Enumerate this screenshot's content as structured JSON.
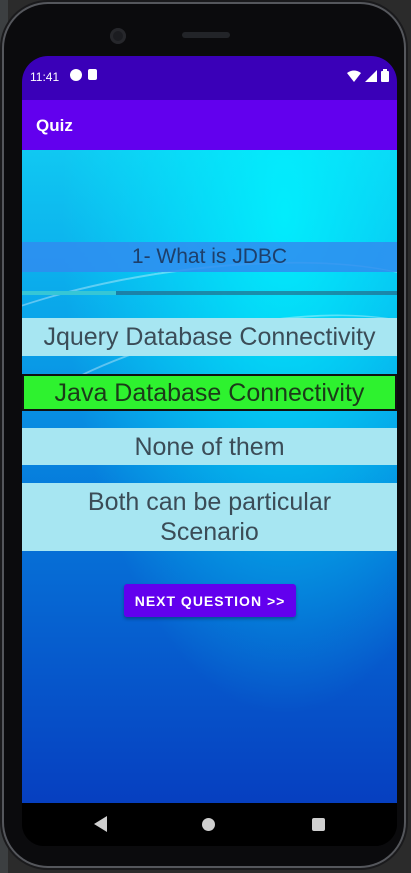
{
  "status_bar": {
    "time": "11:41",
    "left_icons": [
      "settings-icon",
      "sd-card-icon"
    ],
    "right_icons": [
      "wifi-icon",
      "signal-icon",
      "battery-icon"
    ]
  },
  "app_bar": {
    "title": "Quiz",
    "color": "#6200ee"
  },
  "quiz": {
    "question": "1- What is JDBC",
    "progress": 0.25,
    "options": [
      {
        "text": "Jquery Database Connectivity",
        "selected": false
      },
      {
        "text": "Java Database Connectivity",
        "selected": true
      },
      {
        "text": "None of them",
        "selected": false
      },
      {
        "text": "Both can be particular Scenario",
        "selected": false
      }
    ],
    "selected_color": "#2ef22f",
    "next_button_label": "NEXT QUESTION >>"
  },
  "nav_bar": {
    "buttons": [
      "back-icon",
      "home-icon",
      "recents-icon"
    ]
  }
}
